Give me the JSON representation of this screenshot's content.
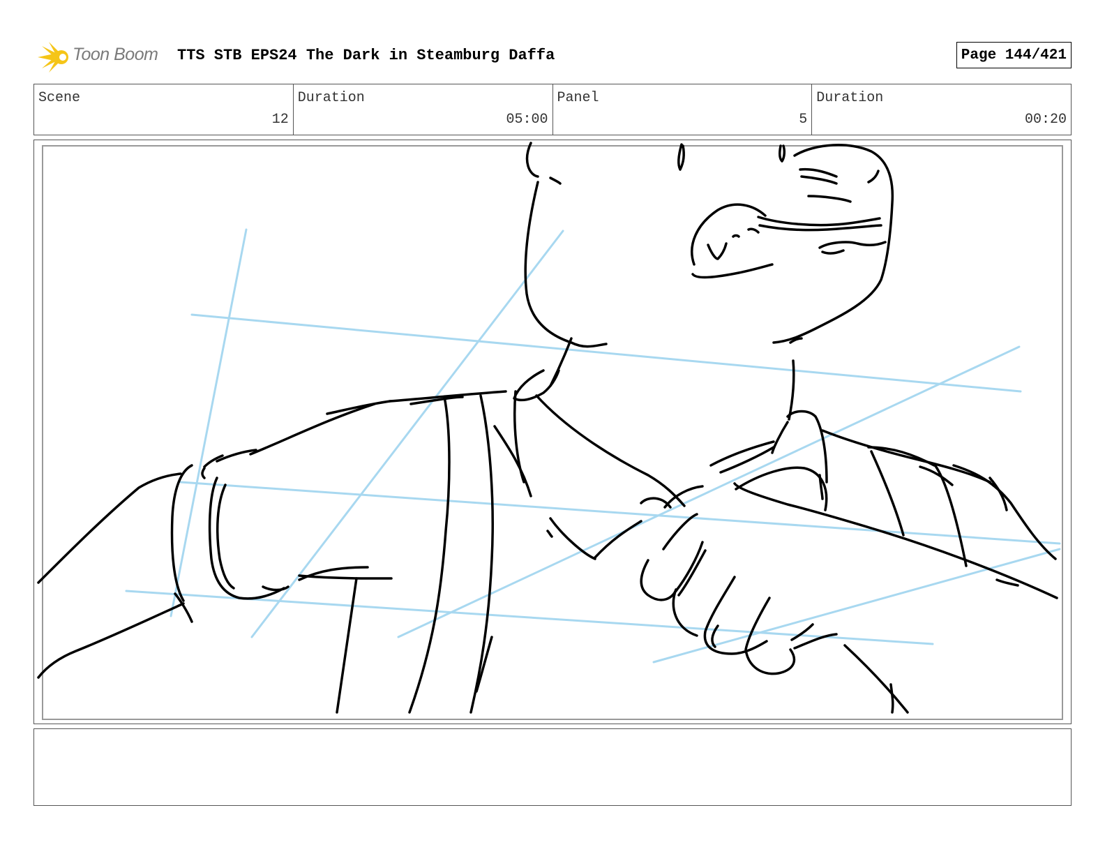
{
  "header": {
    "logo_text": "Toon Boom",
    "title": "TTS STB EPS24 The Dark in Steamburg Daffa",
    "page": "Page 144/421"
  },
  "info": {
    "scene_label": "Scene",
    "scene_value": "12",
    "scene_duration_label": "Duration",
    "scene_duration_value": "05:00",
    "panel_label": "Panel",
    "panel_value": "5",
    "panel_duration_label": "Duration",
    "panel_duration_value": "00:20"
  },
  "colors": {
    "logo_yellow": "#F5C518",
    "construction_blue": "#A8D8F0",
    "ink": "#000000"
  },
  "icons": [
    "toon-boom-logo-icon"
  ],
  "notes": ""
}
